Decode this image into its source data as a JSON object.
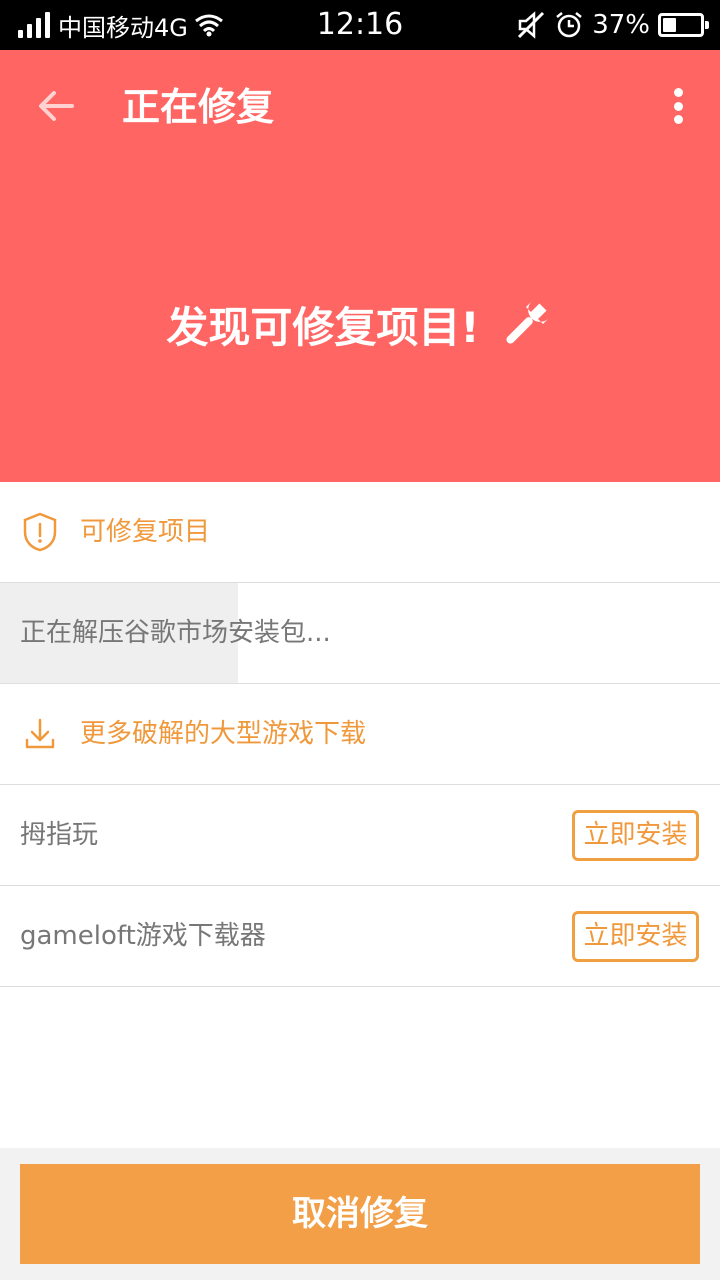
{
  "status_bar": {
    "carrier": "中国移动4G",
    "time": "12:16",
    "battery": "37%",
    "battery_level": 0.37
  },
  "header": {
    "title": "正在修复",
    "hero_text": "发现可修复项目!",
    "hero_icon": "wrench-icon",
    "back_icon": "back-arrow-icon",
    "more_icon": "more-vertical-icon",
    "background_color": "#ff6562"
  },
  "sections": {
    "repairable_header": {
      "label": "可修复项目",
      "icon": "shield-alert-icon"
    },
    "repair_item": {
      "text": "正在解压谷歌市场安装包...",
      "progress": 0.33
    },
    "download_header": {
      "label": "更多破解的大型游戏下载",
      "icon": "download-icon"
    },
    "apps": [
      {
        "name": "拇指玩",
        "action": "立即安装"
      },
      {
        "name": "gameloft游戏下载器",
        "action": "立即安装"
      }
    ]
  },
  "footer": {
    "cancel_label": "取消修复",
    "button_color": "#f29f48"
  },
  "accent_color": "#f0993c"
}
